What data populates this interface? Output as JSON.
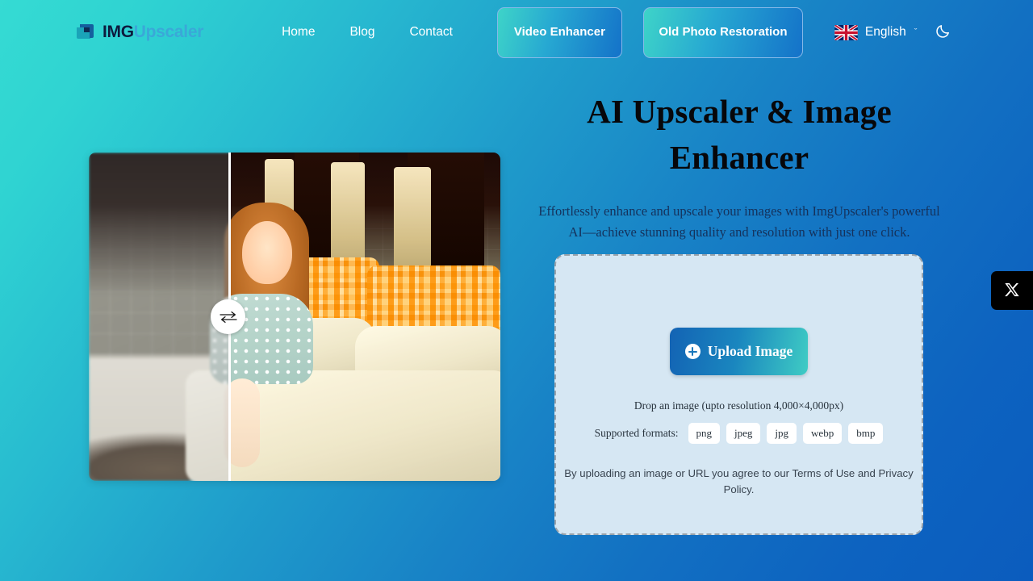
{
  "header": {
    "logo": {
      "part1": "IMG",
      "part2": "Upscaler",
      "icon": "image-logo-icon"
    },
    "nav": [
      {
        "label": "Home"
      },
      {
        "label": "Blog"
      },
      {
        "label": "Contact"
      }
    ],
    "cta_buttons": [
      {
        "label": "Video Enhancer"
      },
      {
        "label": "Old Photo Restoration"
      }
    ],
    "language": {
      "label": "English",
      "flag": "uk-flag-icon",
      "chevron": "ˇ"
    },
    "theme_toggle": {
      "icon": "moon-icon"
    }
  },
  "compare": {
    "handle_icon": "⇄",
    "before_alt": "blurry-low-resolution-photo",
    "after_alt": "sharp-upscaled-photo"
  },
  "hero": {
    "title": "AI Upscaler & Image Enhancer",
    "subtitle": "Effortlessly enhance and upscale your images with ImgUpscaler's powerful AI—achieve stunning quality and resolution with just one click."
  },
  "upload": {
    "button_label": "Upload Image",
    "drop_note": "Drop an image (upto resolution 4,000×4,000px)",
    "formats_label": "Supported formats:",
    "formats": [
      "png",
      "jpeg",
      "jpg",
      "webp",
      "bmp"
    ],
    "terms": "By uploading an image or URL you agree to our Terms of Use and Privacy Policy."
  },
  "social": {
    "x_label": "X"
  },
  "colors": {
    "bg_start": "#35dbd3",
    "bg_end": "#0b5cbe",
    "card_bg": "#d6e7f3",
    "card_border": "#9aa3ab",
    "logo_dark": "#0d1b3e",
    "logo_light": "#3aa8d8"
  }
}
